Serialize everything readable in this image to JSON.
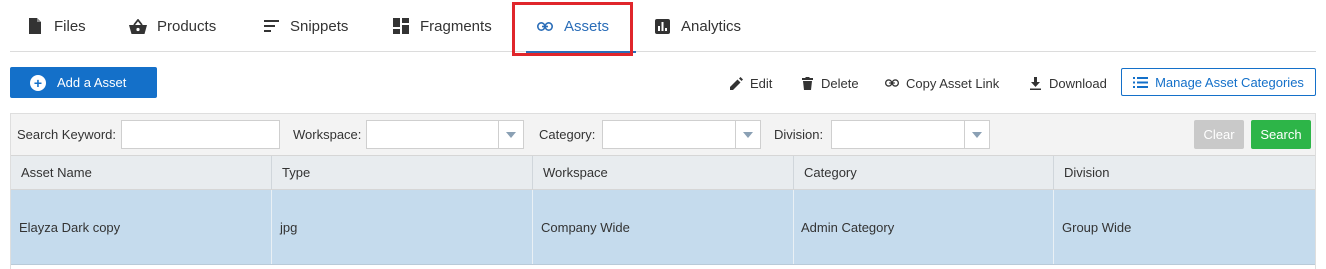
{
  "tabs": [
    {
      "label": "Files",
      "icon": "file-icon"
    },
    {
      "label": "Products",
      "icon": "basket-icon"
    },
    {
      "label": "Snippets",
      "icon": "snippets-icon"
    },
    {
      "label": "Fragments",
      "icon": "fragments-icon"
    },
    {
      "label": "Assets",
      "icon": "link-icon",
      "active": true
    },
    {
      "label": "Analytics",
      "icon": "analytics-icon"
    }
  ],
  "toolbar": {
    "add_label": "Add a Asset",
    "edit_label": "Edit",
    "delete_label": "Delete",
    "copy_link_label": "Copy Asset Link",
    "download_label": "Download",
    "manage_label": "Manage Asset Categories"
  },
  "filters": {
    "keyword_label": "Search Keyword:",
    "keyword_value": "",
    "workspace_label": "Workspace:",
    "workspace_value": "",
    "category_label": "Category:",
    "category_value": "",
    "division_label": "Division:",
    "division_value": "",
    "clear_label": "Clear",
    "search_label": "Search"
  },
  "table": {
    "columns": [
      "Asset Name",
      "Type",
      "Workspace",
      "Category",
      "Division"
    ],
    "rows": [
      [
        "Elayza Dark copy",
        "jpg",
        "Company Wide",
        "Admin Category",
        "Group Wide"
      ]
    ]
  },
  "colors": {
    "accent": "#1470c9",
    "active_tab": "#2a6db8",
    "highlight_box": "#e0262b",
    "search_button": "#2db548",
    "clear_button": "#c9c9c9",
    "selected_row": "#c5dbed",
    "header_bg": "#e8ecef"
  }
}
